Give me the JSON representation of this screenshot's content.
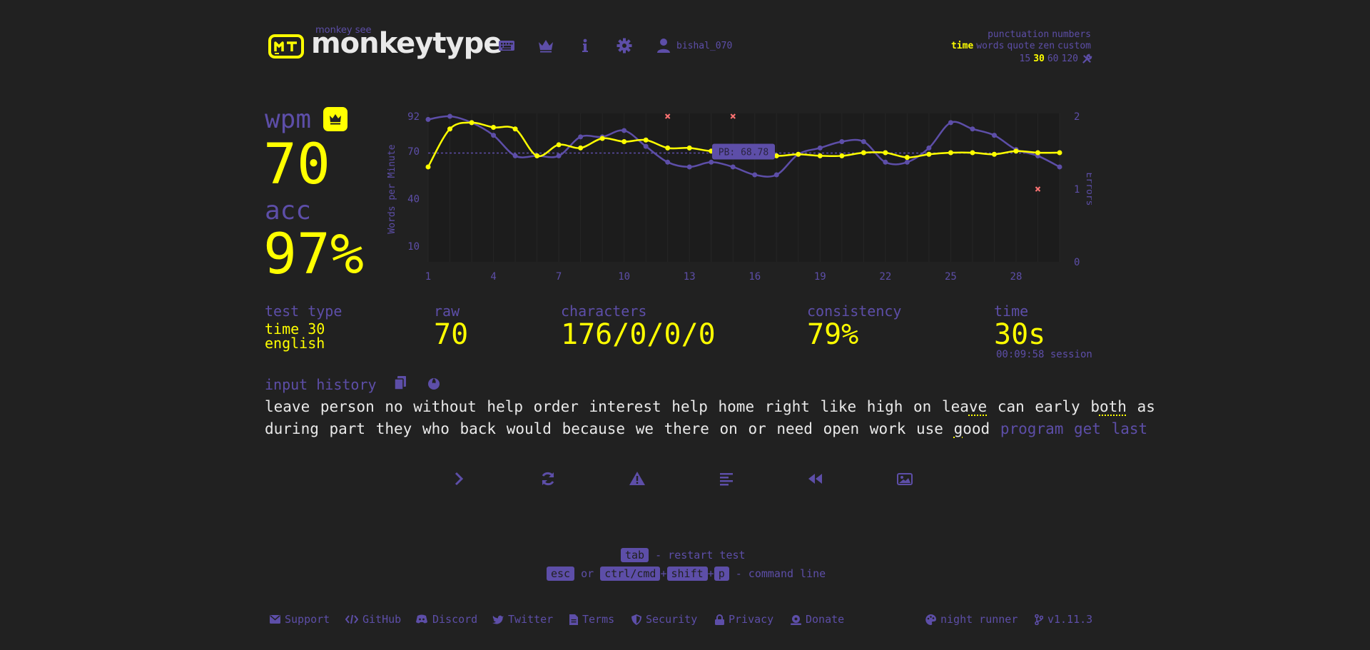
{
  "header": {
    "logo_small": "monkey see",
    "logo_text": "monkeytype",
    "username": "bishal_070",
    "nav_icons": [
      "keyboard-icon",
      "crown-icon",
      "info-icon",
      "gear-icon",
      "user-icon"
    ]
  },
  "config": {
    "row1": [
      "punctuation",
      "numbers"
    ],
    "row2": {
      "active": "time",
      "others": [
        "words",
        "quote",
        "zen",
        "custom"
      ]
    },
    "row3": {
      "options": [
        "15",
        "30",
        "60",
        "120"
      ],
      "active": "30"
    }
  },
  "stats": {
    "wpm_label": "wpm",
    "wpm_value": "70",
    "acc_label": "acc",
    "acc_value": "97%",
    "test_type_label": "test type",
    "test_type_line1": "time 30",
    "test_type_line2": "english",
    "raw_label": "raw",
    "raw_value": "70",
    "characters_label": "characters",
    "characters_value": "176/0/0/0",
    "consistency_label": "consistency",
    "consistency_value": "79%",
    "time_label": "time",
    "time_value": "30s",
    "session_value": "00:09:58 session"
  },
  "chart_data": {
    "type": "line",
    "ylabel": "Words per Minute",
    "y2label": "Errors",
    "x_ticks": [
      1,
      4,
      7,
      10,
      13,
      16,
      19,
      22,
      25,
      28
    ],
    "y_ticks": [
      10,
      40,
      70,
      92
    ],
    "y2_ticks": [
      0,
      1,
      2
    ],
    "ylim": [
      0,
      92
    ],
    "y2lim": [
      0,
      2
    ],
    "pb_label": "PB: 68.78",
    "pb_value": 68.78,
    "x": [
      1,
      2,
      3,
      4,
      5,
      6,
      7,
      8,
      9,
      10,
      11,
      12,
      13,
      14,
      15,
      16,
      17,
      18,
      19,
      20,
      21,
      22,
      23,
      24,
      25,
      26,
      27,
      28,
      29,
      30
    ],
    "series": [
      {
        "name": "wpm",
        "color": "#ffff00",
        "values": [
          60,
          84,
          88,
          85,
          84,
          67,
          74,
          72,
          78,
          76,
          77,
          72,
          72,
          70,
          70,
          69,
          67,
          68,
          67,
          67,
          69,
          69,
          66,
          68,
          69,
          69,
          68,
          70,
          69,
          69
        ]
      },
      {
        "name": "raw",
        "color": "#5d4ea8",
        "values": [
          90,
          92,
          88,
          80,
          67,
          67,
          67,
          79,
          79,
          83,
          73,
          63,
          60,
          63,
          60,
          55,
          55,
          68,
          72,
          76,
          76,
          63,
          63,
          72,
          88,
          84,
          80,
          71,
          67,
          60
        ]
      }
    ],
    "errors": [
      {
        "x": 12,
        "y": 2
      },
      {
        "x": 15,
        "y": 2
      },
      {
        "x": 29,
        "y": 1
      }
    ]
  },
  "input_history": {
    "label": "input history",
    "line1": [
      "leave",
      "person",
      "no",
      "without",
      "help",
      "order",
      "interest",
      "help",
      "home",
      "right",
      "like",
      "high",
      "on"
    ],
    "line1_err_word": {
      "pre": "lea",
      "err": "ve",
      "post": ""
    },
    "line1_tail": [
      "can",
      "early"
    ],
    "line1_err_word2": {
      "pre": "b",
      "err": "oth",
      "post": ""
    },
    "line1_end": "as",
    "line2": [
      "during",
      "part",
      "they",
      "who",
      "back",
      "would",
      "because",
      "we",
      "there",
      "on",
      "or",
      "need",
      "open",
      "work",
      "use"
    ],
    "line2_err_word": {
      "pre": "",
      "err": "g",
      "post": "ood"
    },
    "line2_missed": "program get last"
  },
  "keytips": {
    "tab_key": "tab",
    "tab_text": "- restart test",
    "esc_key": "esc",
    "or_text": "or",
    "ctrl_key": "ctrl/cmd",
    "plus": "+",
    "shift_key": "shift",
    "p_key": "p",
    "cmd_text": "- command line"
  },
  "footer": {
    "links": [
      "Support",
      "GitHub",
      "Discord",
      "Twitter",
      "Terms",
      "Security",
      "Privacy",
      "Donate"
    ],
    "theme": "night runner",
    "version": "v1.11.3"
  },
  "colors": {
    "bg": "#212121",
    "main": "#ffff00",
    "sub": "#5d4ea8",
    "text": "#e9e9e9",
    "error": "#ff7373"
  }
}
